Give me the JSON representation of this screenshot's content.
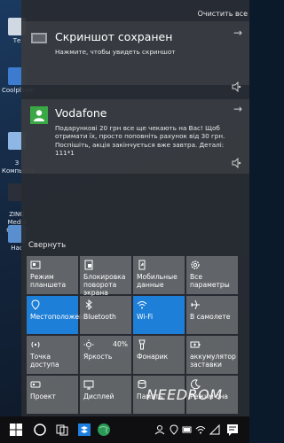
{
  "desktop": {
    "icons": [
      {
        "label": "Те"
      },
      {
        "label": "Coolplayer"
      },
      {
        "label": "З\nКомпьюте"
      },
      {
        "label": "ZINQ Media\nCenter"
      },
      {
        "label": "Нас"
      }
    ]
  },
  "action_center": {
    "clear_all": "Очистить все",
    "notifications": [
      {
        "app_icon": "screenshot-icon",
        "title": "Скриншот сохранен",
        "body": "Нажмите, чтобы увидеть скриншот"
      },
      {
        "app_icon": "person-icon",
        "title": "Vodafone",
        "body": "Подарункові 20 грн все ще чекають на Вас! Щоб отримати їх, просто поповніть рахунок від 30 грн. Поспішіть, акція закінчується вже завтра. Деталі: 111*1"
      }
    ],
    "collapse_label": "Свернуть",
    "quick_actions": [
      {
        "label": "Режим планшета",
        "icon": "tablet-mode-icon",
        "on": false
      },
      {
        "label": "Блокировка поворота экрана",
        "icon": "rotation-lock-icon",
        "on": false
      },
      {
        "label": "Мобильные данные",
        "icon": "mobile-data-icon",
        "on": false
      },
      {
        "label": "Все параметры",
        "icon": "gear-icon",
        "on": false
      },
      {
        "label": "Местоположение",
        "icon": "location-icon",
        "on": true
      },
      {
        "label": "Bluetooth",
        "icon": "bluetooth-icon",
        "on": false
      },
      {
        "label": "Wi-Fi",
        "icon": "wifi-icon",
        "on": true
      },
      {
        "label": "В самолете",
        "icon": "airplane-icon",
        "on": false
      },
      {
        "label": "Точка доступа",
        "icon": "hotspot-icon",
        "on": false
      },
      {
        "label": "Яркость",
        "icon": "brightness-icon",
        "on": false,
        "value": "40%"
      },
      {
        "label": "Фонарик",
        "icon": "flashlight-icon",
        "on": false
      },
      {
        "label": "аккумулятор заставки",
        "icon": "battery-saver-icon",
        "on": false
      },
      {
        "label": "Проект",
        "icon": "project-icon",
        "on": false
      },
      {
        "label": "Дисплей",
        "icon": "display-icon",
        "on": false
      },
      {
        "label": "Память",
        "icon": "storage-icon",
        "on": false
      },
      {
        "label": "Режим сна",
        "icon": "sleep-icon",
        "on": false
      }
    ]
  },
  "watermark": "NEEDROM",
  "colors": {
    "accent": "#1e7fd8",
    "panel": "#2b2f35",
    "tile": "#686a6e"
  }
}
